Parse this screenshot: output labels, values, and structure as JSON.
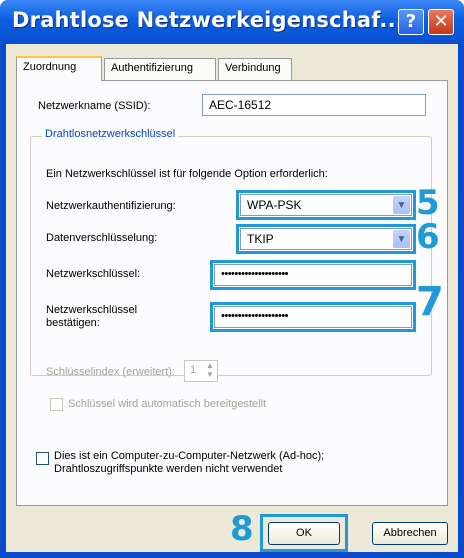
{
  "window": {
    "title": "Drahtlose Netzwerkeigenschaf...",
    "help_label": "?",
    "close_label": "✕"
  },
  "tabs": [
    {
      "label": "Zuordnung",
      "active": true
    },
    {
      "label": "Authentifizierung",
      "active": false
    },
    {
      "label": "Verbindung",
      "active": false
    }
  ],
  "ssid": {
    "label": "Netzwerkname (SSID):",
    "value": "AEC-16512"
  },
  "key_group": {
    "title": "Drahtlosnetzwerkschlüssel",
    "info": "Ein Netzwerkschlüssel ist für folgende Option erforderlich:",
    "auth_label": "Netzwerkauthentifizierung:",
    "auth_value": "WPA-PSK",
    "enc_label": "Datenverschlüsselung:",
    "enc_value": "TKIP",
    "key_label": "Netzwerkschlüssel:",
    "key_value": "••••••••••••••••••••",
    "confirm_label_1": "Netzwerkschlüssel",
    "confirm_label_2": "bestätigen:",
    "confirm_value": "••••••••••••••••••••",
    "index_label": "Schlüsselindex (erweitert):",
    "index_value": "1",
    "auto_key_label": "Schlüssel wird automatisch bereitgestellt"
  },
  "adhoc": {
    "line1": "Dies ist ein Computer-zu-Computer-Netzwerk (Ad-hoc);",
    "line2": "Drahtloszugriffspunkte werden nicht verwendet"
  },
  "buttons": {
    "ok": "OK",
    "cancel": "Abbrechen"
  },
  "callouts": {
    "auth": "5",
    "enc": "6",
    "key": "7",
    "ok": "8"
  },
  "colors": {
    "callout": "#1f9ad6",
    "titlebar": "#0b5fe0"
  }
}
